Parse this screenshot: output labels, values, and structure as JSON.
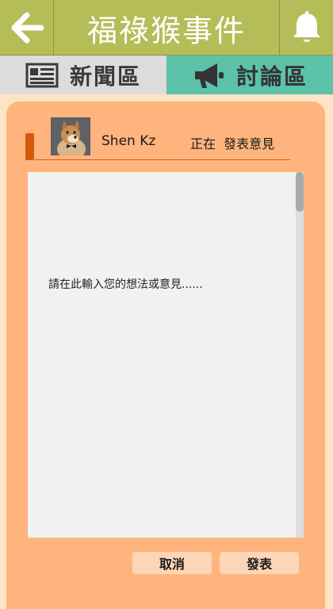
{
  "header": {
    "title": "福祿猴事件",
    "back_icon": "arrow-left-icon",
    "bell_icon": "bell-icon"
  },
  "tabs": [
    {
      "label": "新聞區",
      "icon": "newspaper-icon",
      "active": false
    },
    {
      "label": "討論區",
      "icon": "megaphone-icon",
      "active": true
    }
  ],
  "composer": {
    "username": "Shen Kz",
    "status": "正在  發表意見",
    "placeholder": "請在此輸入您的想法或意見......",
    "cancel_label": "取消",
    "post_label": "發表"
  },
  "colors": {
    "header": "#b5bd58",
    "tab_news": "#dcdcdc",
    "tab_discuss": "#5cc2aa",
    "card": "#ffb47e",
    "accent": "#d45b0a"
  }
}
